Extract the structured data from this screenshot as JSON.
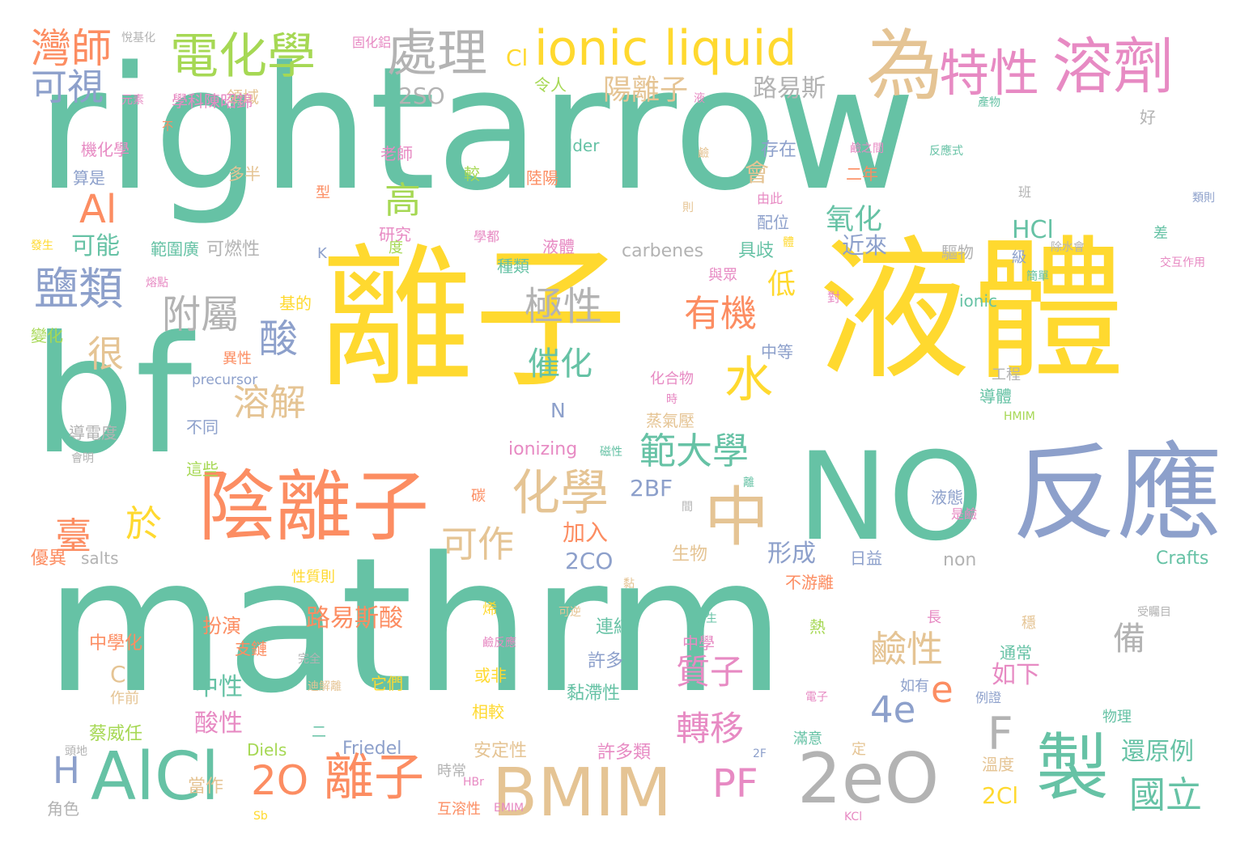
{
  "palette": {
    "teal": "#66c2a5",
    "orange": "#fc8d62",
    "blue": "#8da0cb",
    "pink": "#e78ac3",
    "lime": "#a6d854",
    "yellow": "#ffd92f",
    "tan": "#e5c494",
    "gray": "#b3b3b3"
  },
  "words": [
    {
      "text": "rightarrow",
      "color": "teal"
    },
    {
      "text": "mathrm",
      "color": "teal"
    },
    {
      "text": "離子",
      "color": "yellow"
    },
    {
      "text": "液體",
      "color": "yellow"
    },
    {
      "text": "bf",
      "color": "teal"
    },
    {
      "text": "NO",
      "color": "teal"
    },
    {
      "text": "反應",
      "color": "blue"
    },
    {
      "text": "陰離子",
      "color": "orange"
    },
    {
      "text": "BMIM",
      "color": "tan"
    },
    {
      "text": "2eO",
      "color": "gray"
    },
    {
      "text": "AlCl",
      "color": "teal"
    },
    {
      "text": "為",
      "color": "tan"
    },
    {
      "text": "製",
      "color": "teal"
    },
    {
      "text": "中",
      "color": "tan"
    },
    {
      "text": "ionic liquid",
      "color": "yellow"
    },
    {
      "text": "溶劑",
      "color": "pink"
    },
    {
      "text": "電化學",
      "color": "lime"
    },
    {
      "text": "處理",
      "color": "gray"
    },
    {
      "text": "特性",
      "color": "pink"
    },
    {
      "text": "化學",
      "color": "tan"
    },
    {
      "text": "離子",
      "color": "orange"
    },
    {
      "text": "水",
      "color": "yellow"
    },
    {
      "text": "灣師",
      "color": "orange"
    },
    {
      "text": "可視",
      "color": "blue"
    },
    {
      "text": "2O",
      "color": "orange"
    },
    {
      "text": "PF",
      "color": "pink"
    },
    {
      "text": "臺",
      "color": "orange"
    },
    {
      "text": "於",
      "color": "yellow"
    },
    {
      "text": "鹽類",
      "color": "blue"
    },
    {
      "text": "Al",
      "color": "orange"
    },
    {
      "text": "酸",
      "color": "blue"
    },
    {
      "text": "極性",
      "color": "gray"
    },
    {
      "text": "附屬",
      "color": "gray"
    },
    {
      "text": "有機",
      "color": "orange"
    },
    {
      "text": "範大學",
      "color": "teal"
    },
    {
      "text": "很",
      "color": "tan"
    },
    {
      "text": "高",
      "color": "lime"
    },
    {
      "text": "可作",
      "color": "tan"
    },
    {
      "text": "溶解",
      "color": "tan"
    },
    {
      "text": "催化",
      "color": "teal"
    },
    {
      "text": "4e",
      "color": "blue"
    },
    {
      "text": "鹼性",
      "color": "tan"
    },
    {
      "text": "轉移",
      "color": "pink"
    },
    {
      "text": "質子",
      "color": "pink"
    },
    {
      "text": "國立",
      "color": "teal"
    },
    {
      "text": "e",
      "color": "orange"
    },
    {
      "text": "F",
      "color": "gray"
    },
    {
      "text": "H",
      "color": "blue"
    },
    {
      "text": "陽離子",
      "color": "tan"
    },
    {
      "text": "低",
      "color": "yellow"
    },
    {
      "text": "氧化",
      "color": "teal"
    },
    {
      "text": "路易斯酸",
      "color": "orange"
    },
    {
      "text": "形成",
      "color": "blue"
    },
    {
      "text": "還原例",
      "color": "teal"
    },
    {
      "text": "備",
      "color": "gray"
    },
    {
      "text": "2SO",
      "color": "gray"
    },
    {
      "text": "路易斯",
      "color": "gray"
    },
    {
      "text": "HCl",
      "color": "teal"
    },
    {
      "text": "2BF",
      "color": "blue"
    },
    {
      "text": "2CO",
      "color": "blue"
    },
    {
      "text": "加入",
      "color": "orange"
    },
    {
      "text": "會",
      "color": "tan"
    },
    {
      "text": "如下",
      "color": "pink"
    },
    {
      "text": "中性",
      "color": "teal"
    },
    {
      "text": "酸性",
      "color": "pink"
    },
    {
      "text": "2Cl",
      "color": "yellow"
    },
    {
      "text": "Cl",
      "color": "yellow"
    },
    {
      "text": "可能",
      "color": "teal"
    },
    {
      "text": "近來",
      "color": "blue"
    },
    {
      "text": "carbenes",
      "color": "gray"
    },
    {
      "text": "ionizing",
      "color": "pink"
    },
    {
      "text": "N",
      "color": "blue"
    },
    {
      "text": "C",
      "color": "tan"
    },
    {
      "text": "Alder",
      "color": "teal"
    },
    {
      "text": "Friedel",
      "color": "blue"
    },
    {
      "text": "Diels",
      "color": "lime"
    },
    {
      "text": "Crafts",
      "color": "teal"
    },
    {
      "text": "non",
      "color": "gray"
    },
    {
      "text": "salts",
      "color": "gray"
    },
    {
      "text": "ionic",
      "color": "teal"
    },
    {
      "text": "precursor",
      "color": "blue"
    },
    {
      "text": "蒸氣壓",
      "color": "tan"
    },
    {
      "text": "扮演",
      "color": "orange"
    },
    {
      "text": "中學化",
      "color": "orange"
    },
    {
      "text": "蔡威任",
      "color": "lime"
    },
    {
      "text": "優異",
      "color": "orange"
    },
    {
      "text": "生物",
      "color": "tan"
    },
    {
      "text": "連結",
      "color": "teal"
    },
    {
      "text": "黏滯性",
      "color": "teal"
    },
    {
      "text": "許多",
      "color": "blue"
    },
    {
      "text": "許多類",
      "color": "pink"
    },
    {
      "text": "安定性",
      "color": "tan"
    },
    {
      "text": "時常",
      "color": "gray"
    },
    {
      "text": "互溶性",
      "color": "orange"
    },
    {
      "text": "當作",
      "color": "tan"
    },
    {
      "text": "角色",
      "color": "gray"
    },
    {
      "text": "溫度",
      "color": "tan"
    },
    {
      "text": "通常",
      "color": "teal"
    },
    {
      "text": "液態",
      "color": "blue"
    },
    {
      "text": "二年",
      "color": "orange"
    },
    {
      "text": "具歧",
      "color": "teal"
    },
    {
      "text": "存在",
      "color": "blue"
    },
    {
      "text": "配位",
      "color": "blue"
    },
    {
      "text": "驅物",
      "color": "gray"
    },
    {
      "text": "可燃性",
      "color": "gray"
    },
    {
      "text": "範圍廣",
      "color": "teal"
    },
    {
      "text": "多半",
      "color": "tan"
    },
    {
      "text": "算是",
      "color": "blue"
    },
    {
      "text": "機化學",
      "color": "pink"
    },
    {
      "text": "領域",
      "color": "tan"
    },
    {
      "text": "學科陳昭錦",
      "color": "pink"
    },
    {
      "text": "令人",
      "color": "lime"
    },
    {
      "text": "老師",
      "color": "pink"
    },
    {
      "text": "陸陽",
      "color": "orange"
    },
    {
      "text": "液體",
      "color": "pink"
    },
    {
      "text": "種類",
      "color": "teal"
    },
    {
      "text": "研究",
      "color": "pink"
    },
    {
      "text": "基的",
      "color": "yellow"
    },
    {
      "text": "中等",
      "color": "blue"
    },
    {
      "text": "化合物",
      "color": "pink"
    },
    {
      "text": "導電度",
      "color": "gray"
    },
    {
      "text": "不同",
      "color": "blue"
    },
    {
      "text": "這些",
      "color": "lime"
    },
    {
      "text": "變化",
      "color": "lime"
    },
    {
      "text": "異性",
      "color": "orange"
    },
    {
      "text": "日益",
      "color": "blue"
    },
    {
      "text": "中學",
      "color": "pink"
    },
    {
      "text": "不游離",
      "color": "orange"
    },
    {
      "text": "它們",
      "color": "yellow"
    },
    {
      "text": "或非",
      "color": "yellow"
    },
    {
      "text": "導體",
      "color": "teal"
    },
    {
      "text": "作前",
      "color": "tan"
    },
    {
      "text": "相較",
      "color": "yellow"
    },
    {
      "text": "滿意",
      "color": "teal"
    },
    {
      "text": "定",
      "color": "tan"
    },
    {
      "text": "如有",
      "color": "blue"
    },
    {
      "text": "物理",
      "color": "teal"
    },
    {
      "text": "性質則",
      "color": "yellow"
    },
    {
      "text": "支鏈",
      "color": "orange"
    },
    {
      "text": "二",
      "color": "teal"
    },
    {
      "text": "熱",
      "color": "lime"
    },
    {
      "text": "烯",
      "color": "yellow"
    },
    {
      "text": "碳",
      "color": "orange"
    },
    {
      "text": "較",
      "color": "lime"
    },
    {
      "text": "型",
      "color": "orange"
    },
    {
      "text": "度",
      "color": "lime"
    },
    {
      "text": "與眾",
      "color": "pink"
    },
    {
      "text": "級",
      "color": "blue"
    },
    {
      "text": "穩",
      "color": "tan"
    },
    {
      "text": "長",
      "color": "pink"
    },
    {
      "text": "班",
      "color": "gray"
    },
    {
      "text": "好",
      "color": "gray"
    },
    {
      "text": "差",
      "color": "teal"
    },
    {
      "text": "工程",
      "color": "gray"
    },
    {
      "text": "K",
      "color": "blue"
    },
    {
      "text": "學都",
      "color": "pink"
    },
    {
      "text": "對",
      "color": "pink"
    },
    {
      "text": "由此",
      "color": "pink"
    },
    {
      "text": "除水會",
      "color": "gray"
    },
    {
      "text": "交互作用",
      "color": "pink"
    },
    {
      "text": "產物",
      "color": "teal"
    },
    {
      "text": "反應式",
      "color": "teal"
    },
    {
      "text": "鹼之間",
      "color": "pink"
    },
    {
      "text": "是鹼",
      "color": "pink"
    },
    {
      "text": "例證",
      "color": "blue"
    },
    {
      "text": "受矚目",
      "color": "gray"
    },
    {
      "text": "可逆",
      "color": "tan"
    },
    {
      "text": "衍生",
      "color": "teal"
    },
    {
      "text": "鹼反應",
      "color": "pink"
    },
    {
      "text": "磁性",
      "color": "teal"
    },
    {
      "text": "熔點",
      "color": "pink"
    },
    {
      "text": "元素",
      "color": "pink"
    },
    {
      "text": "悅基化",
      "color": "gray"
    },
    {
      "text": "固化鋁",
      "color": "pink"
    },
    {
      "text": "液",
      "color": "pink"
    },
    {
      "text": "鹼",
      "color": "tan"
    },
    {
      "text": "則",
      "color": "tan"
    },
    {
      "text": "不",
      "color": "orange"
    },
    {
      "text": "類則",
      "color": "blue"
    },
    {
      "text": "發生",
      "color": "yellow"
    },
    {
      "text": "體",
      "color": "yellow"
    },
    {
      "text": "KCl",
      "color": "pink"
    },
    {
      "text": "EMIM",
      "color": "pink"
    },
    {
      "text": "HMIM",
      "color": "lime"
    },
    {
      "text": "HBr",
      "color": "pink"
    },
    {
      "text": "2F",
      "color": "blue"
    },
    {
      "text": "Sb",
      "color": "yellow"
    },
    {
      "text": "電子",
      "color": "pink"
    },
    {
      "text": "迪解離",
      "color": "tan"
    },
    {
      "text": "黏",
      "color": "tan"
    },
    {
      "text": "離",
      "color": "teal"
    },
    {
      "text": "間",
      "color": "gray"
    },
    {
      "text": "時",
      "color": "pink"
    },
    {
      "text": "會明",
      "color": "gray"
    },
    {
      "text": "完全",
      "color": "gray"
    },
    {
      "text": "簡單",
      "color": "teal"
    },
    {
      "text": "頭地",
      "color": "gray"
    },
    {
      "text": "子",
      "color": "pink"
    },
    {
      "text": "本",
      "color": "yellow"
    }
  ]
}
